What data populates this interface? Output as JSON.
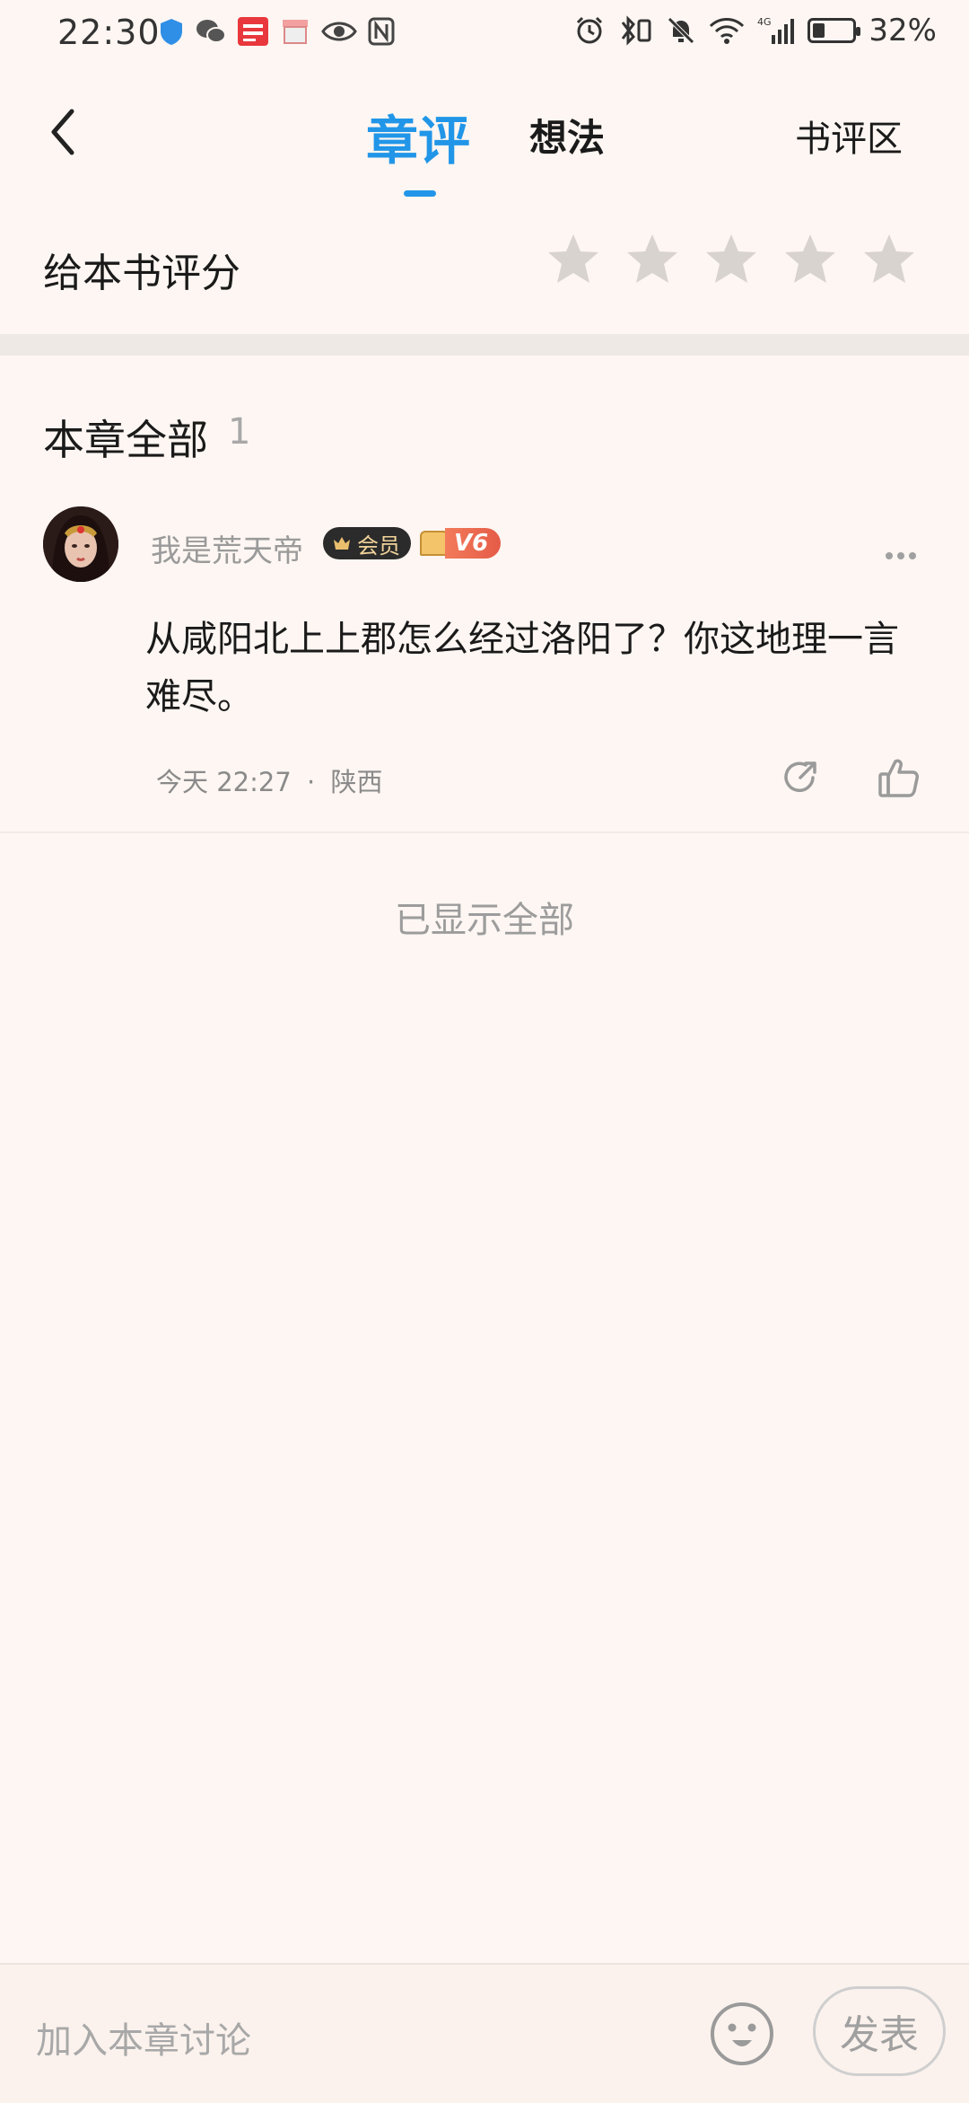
{
  "status_bar": {
    "time": "22:30",
    "battery_percent": "32%",
    "battery_level": 0.32,
    "network": "4G",
    "left_icons": [
      "shield-icon",
      "wechat-icon",
      "toutiao-icon",
      "box-app-icon",
      "eye-icon",
      "nfc-icon"
    ],
    "right_icons": [
      "alarm-icon",
      "bluetooth-icon",
      "mute-icon",
      "wifi-icon",
      "signal-icon",
      "battery-icon"
    ]
  },
  "header": {
    "back_icon": "chevron-left-icon",
    "tabs": [
      {
        "label": "章评",
        "active": true
      },
      {
        "label": "想法",
        "active": false
      }
    ],
    "review_area": "书评区",
    "accent_color": "#2196e8"
  },
  "rating": {
    "label": "给本书评分",
    "star_count": 5,
    "value": 0
  },
  "section": {
    "title": "本章全部",
    "count": "1"
  },
  "comment": {
    "username": "我是荒天帝",
    "member_badge": "会员",
    "level_badge": "V6",
    "text": "从咸阳北上上郡怎么经过洛阳了？你这地理一言难尽。",
    "time": "今天 22:27",
    "separator": "·",
    "location": "陕西"
  },
  "footer_note": "已显示全部",
  "bottom_bar": {
    "input_placeholder": "加入本章讨论",
    "publish_label": "发表"
  }
}
